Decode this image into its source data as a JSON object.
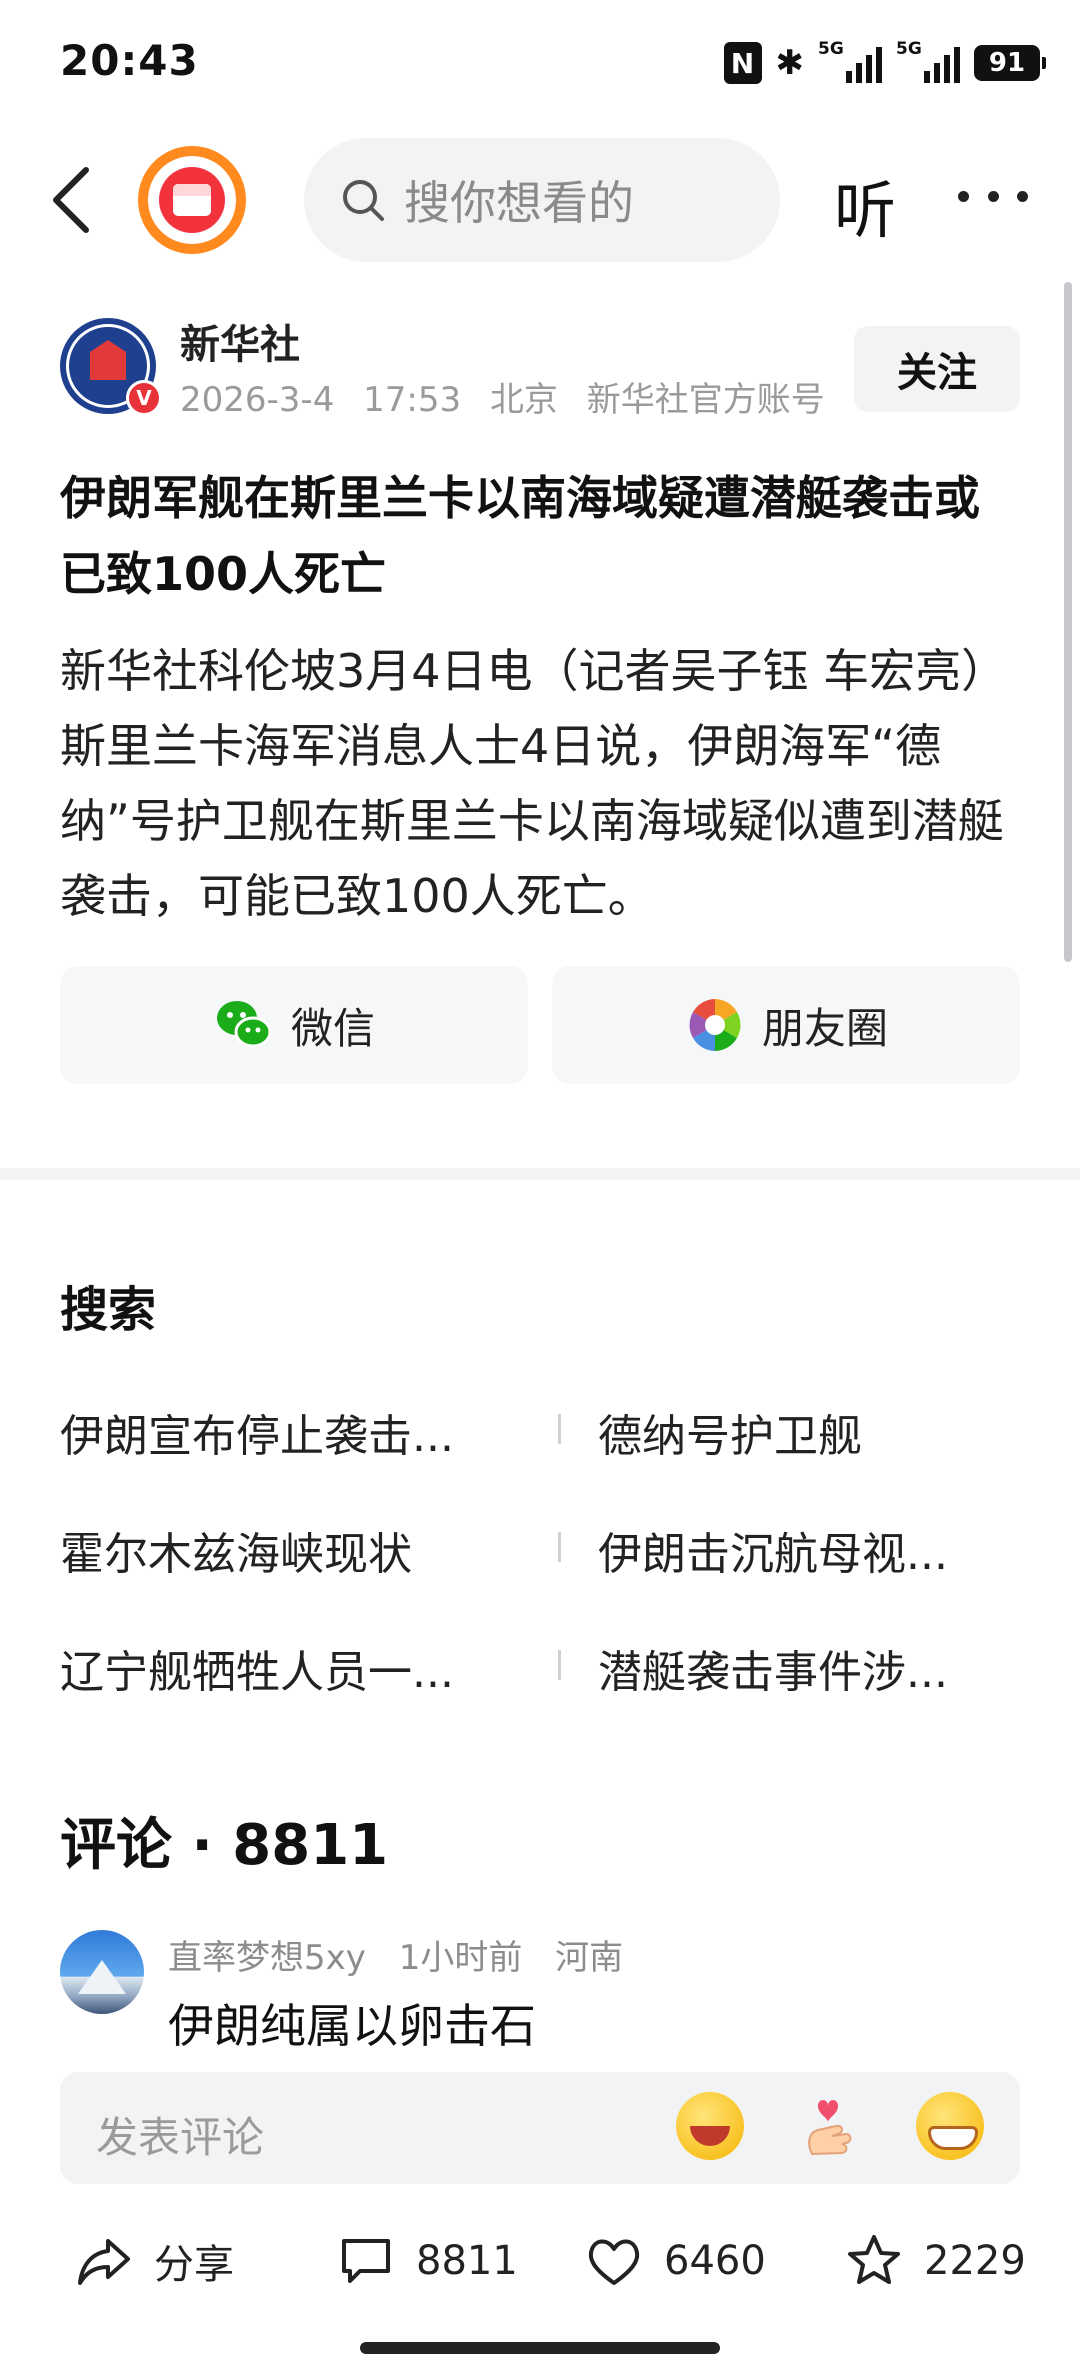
{
  "status_bar": {
    "time": "20:43",
    "nfc": "N",
    "bluetooth": "✱",
    "signal1_label": "5G",
    "signal2_label": "5G",
    "battery": "91"
  },
  "nav": {
    "search_placeholder": "搜你想看的",
    "listen_label": "听"
  },
  "author": {
    "name": "新华社",
    "date": "2026-3-4",
    "time": "17:53",
    "location": "北京",
    "account_type": "新华社官方账号",
    "follow_label": "关注",
    "badge": "V"
  },
  "article": {
    "title": "伊朗军舰在斯里兰卡以南海域疑遭潜艇袭击或已致100人死亡",
    "body": "新华社科伦坡3月4日电（记者吴子钰 车宏亮）斯里兰卡海军消息人士4日说，伊朗海军“德纳”号护卫舰在斯里兰卡以南海域疑似遭到潜艇袭击，可能已致100人死亡。"
  },
  "share": {
    "wechat_label": "微信",
    "moments_label": "朋友圈"
  },
  "search_section": {
    "title": "搜索",
    "items": [
      "伊朗宣布停止袭击...",
      "德纳号护卫舰",
      "霍尔木兹海峡现状",
      "伊朗击沉航母视...",
      "辽宁舰牺牲人员一...",
      "潜艇袭击事件涉..."
    ]
  },
  "comments": {
    "title": "评论 · 8811",
    "first": {
      "user": "直率梦想5xy",
      "time": "1小时前",
      "location": "河南",
      "text": "伊朗纯属以卵击石"
    },
    "input_placeholder": "发表评论"
  },
  "bottom_bar": {
    "share_label": "分享",
    "comment_count": "8811",
    "like_count": "6460",
    "favorite_count": "2229"
  },
  "colors": {
    "accent_orange": "#ff8a1f",
    "accent_red": "#f2323c",
    "wechat_green": "#1aad19"
  }
}
